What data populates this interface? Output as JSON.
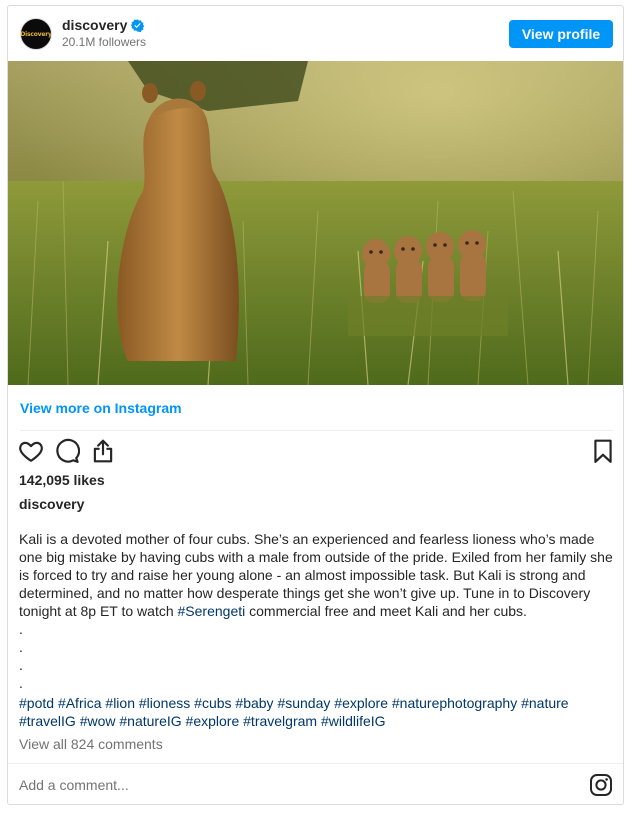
{
  "header": {
    "avatar_text": "Discovery",
    "username": "discovery",
    "followers": "20.1M followers",
    "view_profile": "View profile"
  },
  "post": {
    "view_more": "View more on Instagram",
    "likes": "142,095 likes",
    "owner": "discovery",
    "caption_parts": [
      "Kali is a devoted mother of four cubs. She’s an experienced and fearless lioness who’s made one big mistake by having cubs with a male from outside of the pride. Exiled from her family she is forced to try and raise her young alone - an almost impossible task. But Kali is strong and determined, and no matter how desperate things get she won’t give up. Tune in to Discovery tonight at 8p ET to watch ",
      "#Serengeti",
      " commercial free and meet Kali and her cubs."
    ],
    "dots": [
      ".",
      ".",
      ".",
      "."
    ],
    "hashtags": [
      "#potd",
      "#Africa",
      "#lion",
      "#lioness",
      "#cubs",
      "#baby",
      "#sunday",
      "#explore",
      "#naturephotography",
      "#nature",
      "#travelIG",
      "#wow",
      "#natureIG",
      "#explore",
      "#travelgram",
      "#wildlifeIG"
    ],
    "comments_link": "View all 824 comments"
  },
  "comment_bar": {
    "placeholder": "Add a comment..."
  },
  "colors": {
    "accent": "#0095f6",
    "hashtag": "#00376b",
    "muted": "#737373"
  },
  "icons": [
    "verified-badge-icon",
    "heart-icon",
    "comment-icon",
    "share-icon",
    "bookmark-icon",
    "instagram-icon"
  ]
}
